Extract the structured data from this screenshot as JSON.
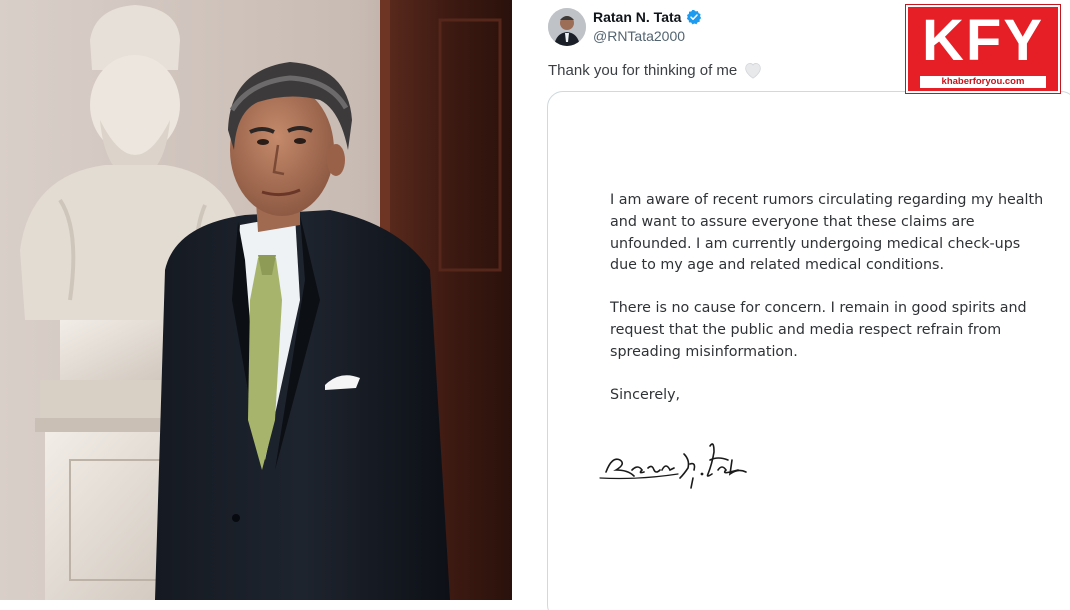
{
  "tweet": {
    "author_name": "Ratan N. Tata",
    "handle": "@RNTata2000",
    "text": "Thank you for thinking of me",
    "verified_icon": "verified-badge-icon",
    "heart_icon": "white-heart-emoji"
  },
  "letter": {
    "paragraphs": [
      "I am aware of recent rumors circulating regarding my health and want to assure everyone that these claims are unfounded. I am currently undergoing medical check-ups due to my age and related medical conditions.",
      "There is no cause for concern. I remain in good spirits and request that the public and media respect refrain from spreading misinformation.",
      "Sincerely,"
    ],
    "signature": "Ratan N. Tata"
  },
  "logo": {
    "letters": "KFY",
    "url": "khaberforyou.com"
  },
  "colors": {
    "brand_red": "#e61e25",
    "verified_blue": "#1d9bf0",
    "text_primary": "#0f1419",
    "text_secondary": "#536471",
    "card_border": "#cfd9de"
  }
}
